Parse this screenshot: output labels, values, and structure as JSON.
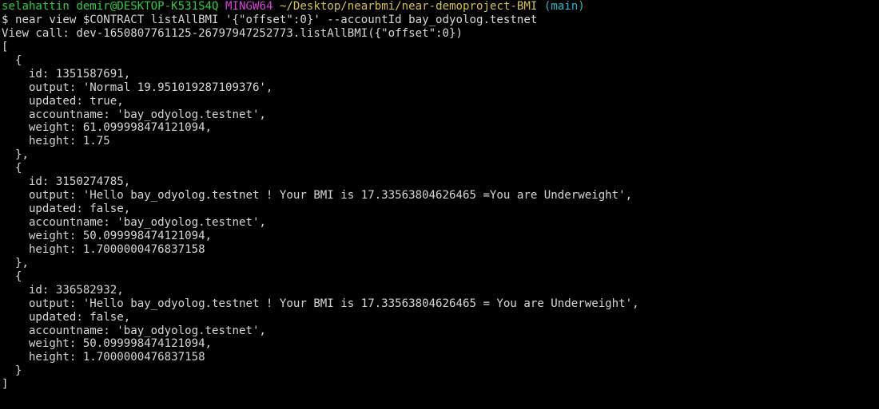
{
  "prompt": {
    "user_host": "selahattin demir@DESKTOP-K531S4Q",
    "shell": "MINGW64",
    "cwd": "~/Desktop/nearbmi/near-demoproject-BMI",
    "branch": "(main)"
  },
  "command": "$ near view $CONTRACT listAllBMI '{\"offset\":0}' --accountId bay_odyolog.testnet",
  "output_lines": [
    "View call: dev-1650807761125-26797947252773.listAllBMI({\"offset\":0})",
    "[",
    "  {",
    "    id: 1351587691,",
    "    output: 'Normal 19.951019287109376',",
    "    updated: true,",
    "    accountname: 'bay_odyolog.testnet',",
    "    weight: 61.099998474121094,",
    "    height: 1.75",
    "  },",
    "  {",
    "    id: 3150274785,",
    "    output: 'Hello bay_odyolog.testnet ! Your BMI is 17.33563804626465 =You are Underweight',",
    "    updated: false,",
    "    accountname: 'bay_odyolog.testnet',",
    "    weight: 50.099998474121094,",
    "    height: 1.7000000476837158",
    "  },",
    "  {",
    "    id: 336582932,",
    "    output: 'Hello bay_odyolog.testnet ! Your BMI is 17.33563804626465 = You are Underweight',",
    "    updated: false,",
    "    accountname: 'bay_odyolog.testnet',",
    "    weight: 50.099998474121094,",
    "    height: 1.7000000476837158",
    "  }",
    "]"
  ],
  "colors": {
    "background": "#000000",
    "text": "#d6d6d6",
    "user_host": "#2ecc40",
    "shell": "#d742d7",
    "cwd": "#d6c14a",
    "branch": "#22b7c8"
  }
}
